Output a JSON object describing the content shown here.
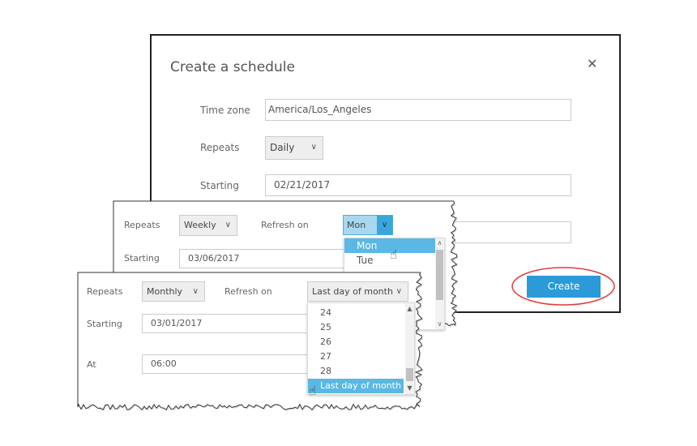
{
  "dialog": {
    "title": "Create a schedule",
    "close_icon": "close-icon",
    "time_zone_label": "Time zone",
    "time_zone_value": "America/Los_Angeles",
    "repeats_label": "Repeats",
    "repeats_value": "Daily",
    "starting_label": "Starting",
    "starting_value": "02/21/2017",
    "create_label": "Create",
    "create_color": "#2a9bd8",
    "highlight_color": "#e03c3c"
  },
  "weekly_panel": {
    "repeats_label": "Repeats",
    "repeats_value": "Weekly",
    "refresh_label": "Refresh on",
    "refresh_value": "Mon",
    "starting_label": "Starting",
    "starting_value": "03/06/2017",
    "options": [
      "Mon",
      "Tue"
    ],
    "selected": "Mon"
  },
  "monthly_panel": {
    "repeats_label": "Repeats",
    "repeats_value": "Monthly",
    "refresh_label": "Refresh on",
    "refresh_value": "Last day of month",
    "starting_label": "Starting",
    "starting_value": "03/01/2017",
    "at_label": "At",
    "at_value": "06:00",
    "options": [
      "24",
      "25",
      "26",
      "27",
      "28",
      "Last day of month"
    ],
    "selected": "Last day of month"
  }
}
